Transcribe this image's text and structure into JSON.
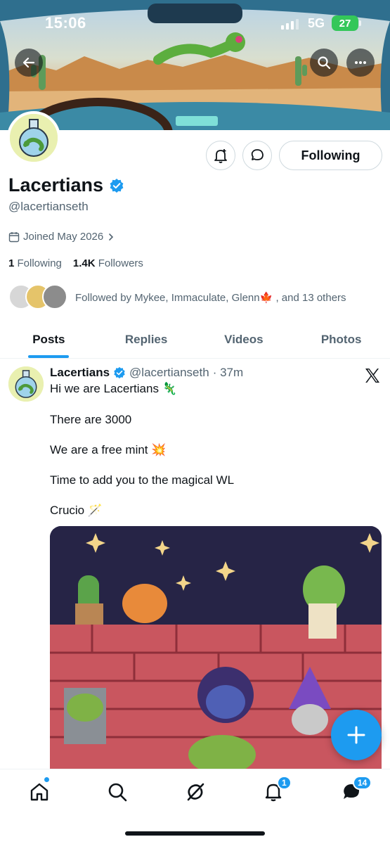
{
  "status_bar": {
    "time": "15:06",
    "network": "5G",
    "battery": "27"
  },
  "header": {
    "back_icon": "arrow-left-icon",
    "search_icon": "search-icon",
    "more_icon": "more-horizontal-icon"
  },
  "profile": {
    "name": "Lacertians",
    "handle": "@lacertianseth",
    "joined": "Joined May 2026",
    "following_count": "1",
    "following_label": "Following",
    "followers_count": "1.4K",
    "followers_label": "Followers",
    "followed_by": "Followed by Mykee, Immaculate, Glenn🍁 , and 13 others",
    "follow_button": "Following"
  },
  "tabs": [
    {
      "label": "Posts",
      "active": true
    },
    {
      "label": "Replies",
      "active": false
    },
    {
      "label": "Videos",
      "active": false
    },
    {
      "label": "Photos",
      "active": false
    }
  ],
  "post": {
    "author": "Lacertians",
    "handle": "@lacertianseth",
    "time": "· 37m",
    "lines": [
      "Hi we are Lacertians 🦎",
      "There are 3000",
      "We are a free mint 💥",
      "Time to add you to the magical WL",
      "Crucio 🪄"
    ]
  },
  "bottom_nav": {
    "items": [
      "home-icon",
      "search-icon",
      "grok-icon",
      "notifications-icon",
      "messages-icon"
    ],
    "notifications_badge": "1",
    "messages_badge": "14"
  },
  "colors": {
    "accent": "#1d9bf0",
    "text": "#0f1419",
    "muted": "#536471"
  }
}
